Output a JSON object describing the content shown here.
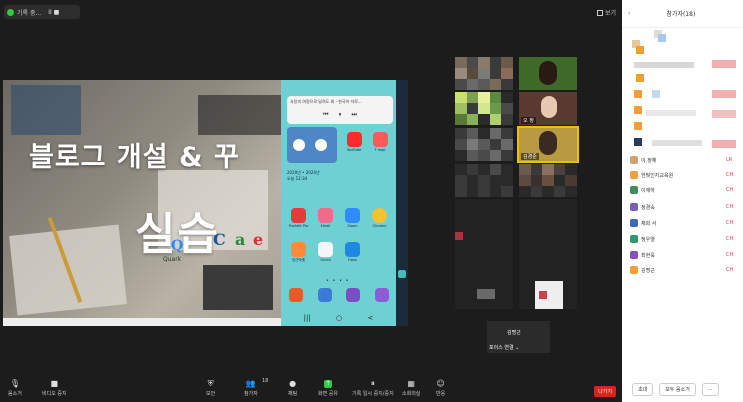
{
  "window": {
    "recording_chip": "기록 중...",
    "recording_controls": "II  ■",
    "view_label": "보기"
  },
  "slide": {
    "title": "블로그 개설 & 꾸",
    "big_text": "실습",
    "logo_letters": [
      "Q",
      "C",
      "a",
      "e"
    ],
    "logo_caption": "Quark"
  },
  "phone": {
    "notif_text": "사랑의 여정으로 달려도 회 - 한국어 자로...",
    "notif_controls": [
      "⏮",
      "⏸",
      "⏭"
    ],
    "info_lines": [
      "2020년 • 2024년",
      "오늘 12:34"
    ],
    "apps_row1": [
      {
        "label": "YouTube",
        "color": "#ff2a2a"
      },
      {
        "label": "T map",
        "color": "#ff5a5a"
      }
    ],
    "apps_row2": [
      {
        "label": "Pushbit Pro",
        "color": "#e83a3a"
      },
      {
        "label": "Email",
        "color": "#f06a8a"
      },
      {
        "label": "Zoom",
        "color": "#2d8cff"
      },
      {
        "label": "Chrome",
        "color": "#f2c230"
      }
    ],
    "apps_row3": [
      {
        "label": "당근마켓",
        "color": "#ff8a3d"
      },
      {
        "label": "Gmail",
        "color": "#f5f5f5"
      },
      {
        "label": "Flash",
        "color": "#1e88e5"
      }
    ],
    "dock_colors": [
      "#e85a2a",
      "#3a7bd5",
      "#7b4fc4",
      "#8c5cd6"
    ],
    "page_dots": "• • • •",
    "nav": [
      "|||",
      "○",
      "<"
    ]
  },
  "video_tiles": [
    {
      "name": "",
      "blur": true
    },
    {
      "name": "",
      "blur": false
    },
    {
      "name": "",
      "blur": true
    },
    {
      "name": "오 정",
      "blur": false
    },
    {
      "name": "",
      "blur": true
    },
    {
      "name": "김경준",
      "blur": false,
      "active": true
    },
    {
      "name": "",
      "blur": true
    },
    {
      "name": "",
      "blur": true
    }
  ],
  "self_view": {
    "name": "김명근",
    "status": "포이스 연결 ⌄"
  },
  "participants": {
    "header": "참가자(18)",
    "collapse_icon": "‹",
    "list": [
      {
        "name": "이 정혜",
        "avatar_color": "#d4a373",
        "avatar_text": "",
        "muted": "LR"
      },
      {
        "name": "한빛인지교육원",
        "avatar_color": "#f0a040",
        "avatar_text": "한",
        "muted": "CH"
      },
      {
        "name": "이재하",
        "avatar_color": "#3e8e5e",
        "avatar_text": "이재",
        "muted": "CH"
      },
      {
        "name": "정경숙",
        "avatar_color": "#7c5fb8",
        "avatar_text": "정",
        "muted": "CH"
      },
      {
        "name": "채희 서",
        "avatar_color": "#3d6bb8",
        "avatar_text": "채",
        "muted": "CH"
      },
      {
        "name": "정우열",
        "avatar_color": "#2e9c6a",
        "avatar_text": "정",
        "muted": "CH"
      },
      {
        "name": "최현욱",
        "avatar_color": "#8a4fbf",
        "avatar_text": "최",
        "muted": "CH"
      },
      {
        "name": "김명근",
        "avatar_color": "#f0a030",
        "avatar_text": "김",
        "muted": "CH"
      }
    ],
    "footer_buttons": [
      "초대",
      "모두 음소거",
      "..."
    ]
  },
  "toolbar": {
    "mute": "음소거",
    "video": "비디오 중지",
    "security": "보안",
    "participants": "참가자",
    "participants_count": "18",
    "chat": "채팅",
    "share": "화면 공유",
    "record": "기록 일시 중지/중지",
    "breakout": "소회의실",
    "reactions": "반응",
    "leave": "나가기"
  }
}
